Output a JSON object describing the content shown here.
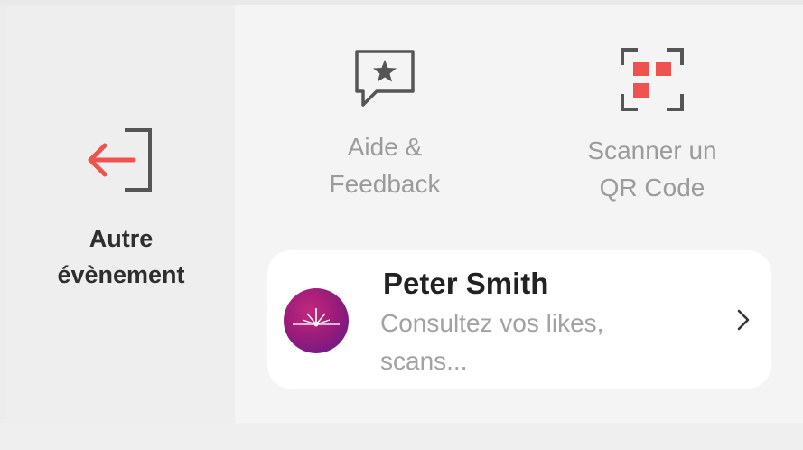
{
  "actions": {
    "other_event": {
      "label": "Autre\névènement",
      "icon": "exit-arrow-icon",
      "arrow_color": "#ef5350",
      "frame_color": "#555555"
    },
    "help_feedback": {
      "label": "Aide &\nFeedback",
      "icon": "star-speech-bubble-icon"
    },
    "scan_qr": {
      "label": "Scanner un\nQR Code",
      "icon": "qr-scan-icon",
      "accent_color": "#ef5350"
    }
  },
  "profile": {
    "name": "Peter Smith",
    "subtitle": "Consultez vos likes, scans...",
    "avatar": "event-logo-avatar",
    "chevron": "chevron-right-icon"
  }
}
